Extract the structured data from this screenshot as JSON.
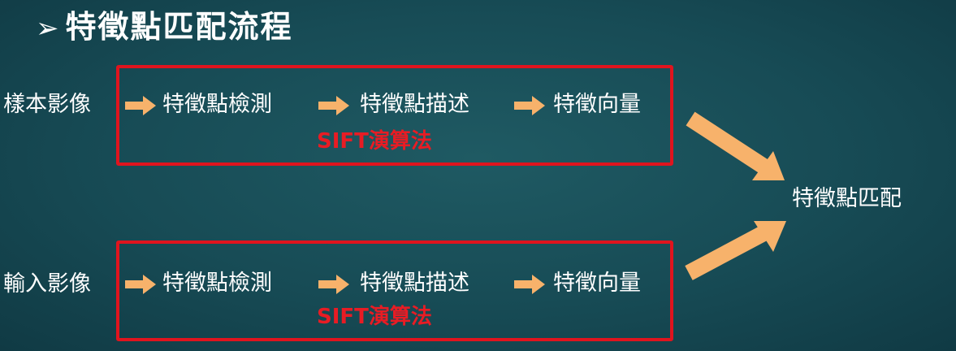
{
  "title": "特徵點匹配流程",
  "rows": [
    {
      "input": "樣本影像",
      "steps": [
        "特徵點檢測",
        "特徵點描述",
        "特徵向量"
      ],
      "algorithm": "SIFT演算法"
    },
    {
      "input": "輸入影像",
      "steps": [
        "特徵點檢測",
        "特徵點描述",
        "特徵向量"
      ],
      "algorithm": "SIFT演算法"
    }
  ],
  "output": "特徵點匹配",
  "colors": {
    "background": "#174b55",
    "arrow": "#f7b26b",
    "box": "#e0141e",
    "algorithm_text": "#e81c24",
    "text": "#ffffff"
  }
}
